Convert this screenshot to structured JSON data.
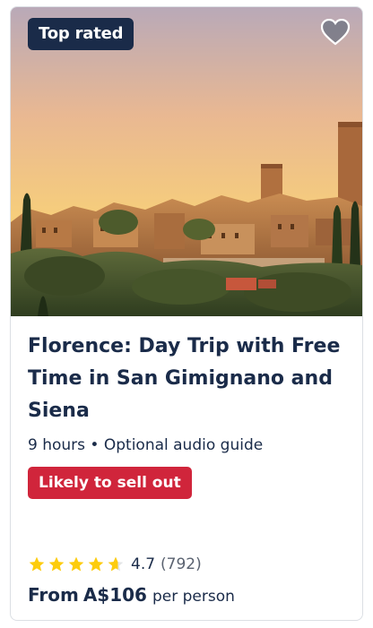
{
  "card": {
    "badge": "Top rated",
    "image_alt": "San Gimignano hill town towers at sunset",
    "wishlist_icon": "heart-icon",
    "title": "Florence: Day Trip with Free Time in San Gimignano and Siena",
    "duration": "9 hours",
    "separator": "•",
    "feature": "Optional audio guide",
    "availability_pill": "Likely to sell out",
    "rating": {
      "value": "4.7",
      "count": "(792)",
      "stars": 4.7,
      "star_icon": "star-icon",
      "star_color": "#fdcc0d"
    },
    "price": {
      "prefix": "From",
      "amount": "A$106",
      "suffix": "per person"
    }
  },
  "colors": {
    "text": "#1a2b49",
    "badge_bg": "#1a2b49",
    "pill_bg": "#d0253b",
    "border": "#dcdfe4"
  }
}
